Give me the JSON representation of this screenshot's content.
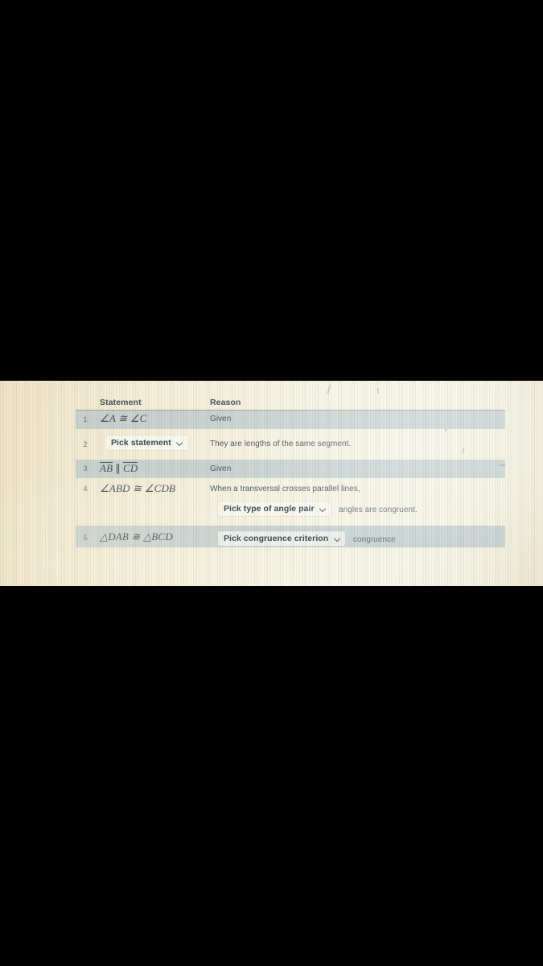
{
  "panel": {
    "headers": {
      "statement": "Statement",
      "reason": "Reason"
    },
    "rows": [
      {
        "num": "1",
        "statement": "∠A ≅ ∠C",
        "reason": "Given"
      },
      {
        "num": "2",
        "statement_dropdown": "Pick statement",
        "reason": "They are lengths of the same segment."
      },
      {
        "num": "3",
        "statement_prefix": "AB",
        "statement_symbol": "∥",
        "statement_suffix": "CD",
        "reason": "Given"
      },
      {
        "num": "4",
        "statement": "∠ABD ≅ ∠CDB",
        "reason_line1": "When a transversal crosses parallel lines,",
        "reason_dropdown": "Pick type of angle pair",
        "reason_tail": "angles are congruent."
      },
      {
        "num": "5",
        "statement": "△DAB ≅ △BCD",
        "reason_dropdown": "Pick congruence criterion",
        "reason_tail": "congruence"
      }
    ],
    "icons": {
      "chevron": "chevron-down-icon"
    },
    "colors": {
      "paper": "#faf4e6",
      "band": "#b0c2d0",
      "text": "#46505e",
      "rule": "#606a74"
    }
  }
}
